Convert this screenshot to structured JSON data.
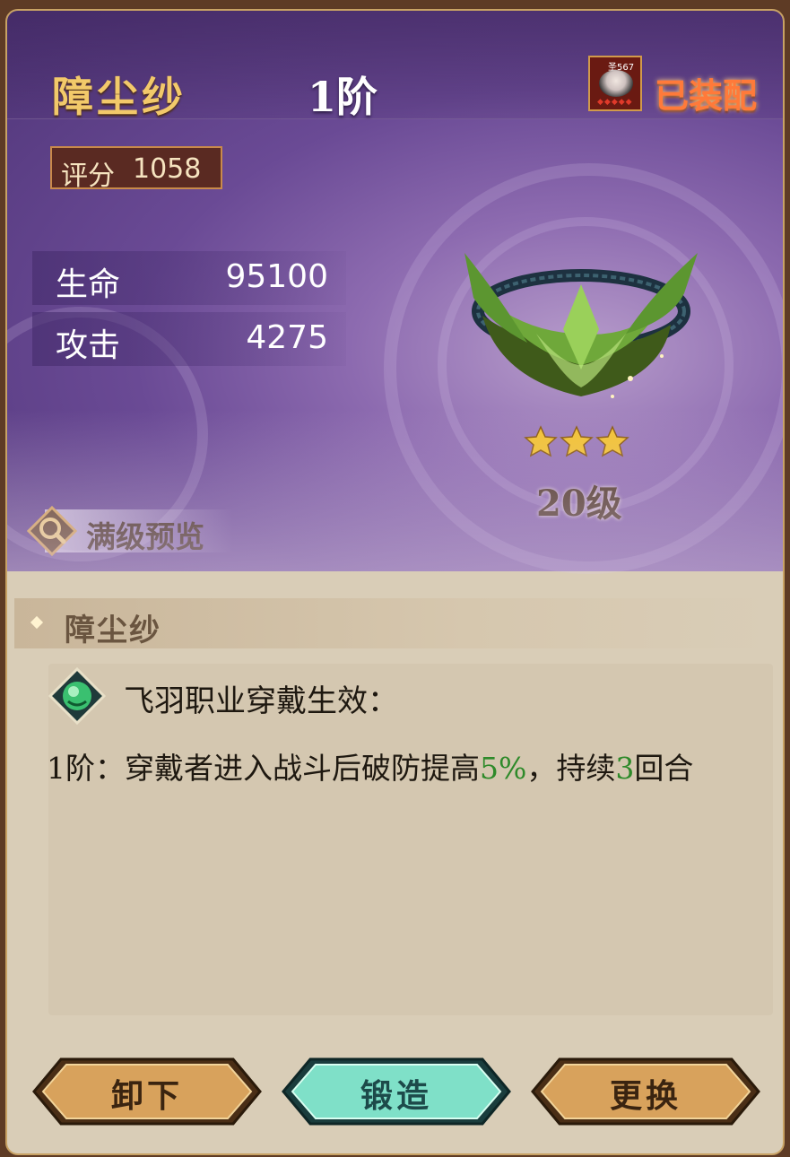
{
  "item": {
    "name": "障尘纱",
    "tier": "1阶",
    "equipped_label": "已装配",
    "equipped_avatar_level": "圣567级",
    "score_label": "评分",
    "score_value": "1058",
    "stats": [
      {
        "label": "生命",
        "value": "95100"
      },
      {
        "label": "攻击",
        "value": "4275"
      }
    ],
    "stars": 3,
    "level": "20级",
    "full_level_preview": "满级预览"
  },
  "section": {
    "title": "障尘纱",
    "effect_title": "飞羽职业穿戴生效：",
    "effect_desc_prefix": "1阶：穿戴者进入战斗后破防提高",
    "effect_desc_value1": "5%",
    "effect_desc_mid": "，持续",
    "effect_desc_value2": "3",
    "effect_desc_suffix": "回合"
  },
  "buttons": {
    "unequip": "卸下",
    "forge": "锻造",
    "replace": "更换"
  },
  "colors": {
    "title_gold": "#f2c96a",
    "equipped_orange": "#ff7a3a",
    "highlight_green": "#2e8a2a",
    "panel_bg": "#d9cdb7",
    "purple_bg": "#6a4a95"
  }
}
